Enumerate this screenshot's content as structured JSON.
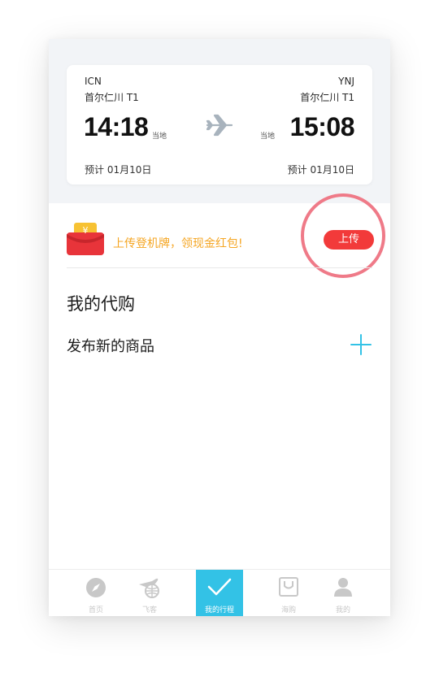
{
  "flight": {
    "origin_code": "ICN",
    "origin_airport": "首尔仁川 T1",
    "dest_code": "YNJ",
    "dest_airport": "首尔仁川 T1",
    "depart_time": "14:18",
    "arrive_time": "15:08",
    "local_tag": "当地",
    "depart_eta": "预计 01月10日",
    "arrive_eta": "预计 01月10日"
  },
  "promo": {
    "envelope_symbol": "¥",
    "text": "上传登机牌，领现金红包!",
    "upload_label": "上传"
  },
  "section": {
    "title": "我的代购",
    "post_label": "发布新的商品"
  },
  "tabbar": {
    "tabs": [
      {
        "label": "首页",
        "icon": "compass-icon"
      },
      {
        "label": "飞客",
        "icon": "plane-globe-icon"
      },
      {
        "label": "我的行程",
        "icon": "check-icon",
        "active": true
      },
      {
        "label": "海购",
        "icon": "shopping-bag-icon"
      },
      {
        "label": "我的",
        "icon": "person-icon"
      }
    ]
  },
  "colors": {
    "accent": "#33c2e6",
    "promo_text": "#f5a623",
    "upload_button": "#f23a3a",
    "highlight_ring": "#ef7a88"
  }
}
